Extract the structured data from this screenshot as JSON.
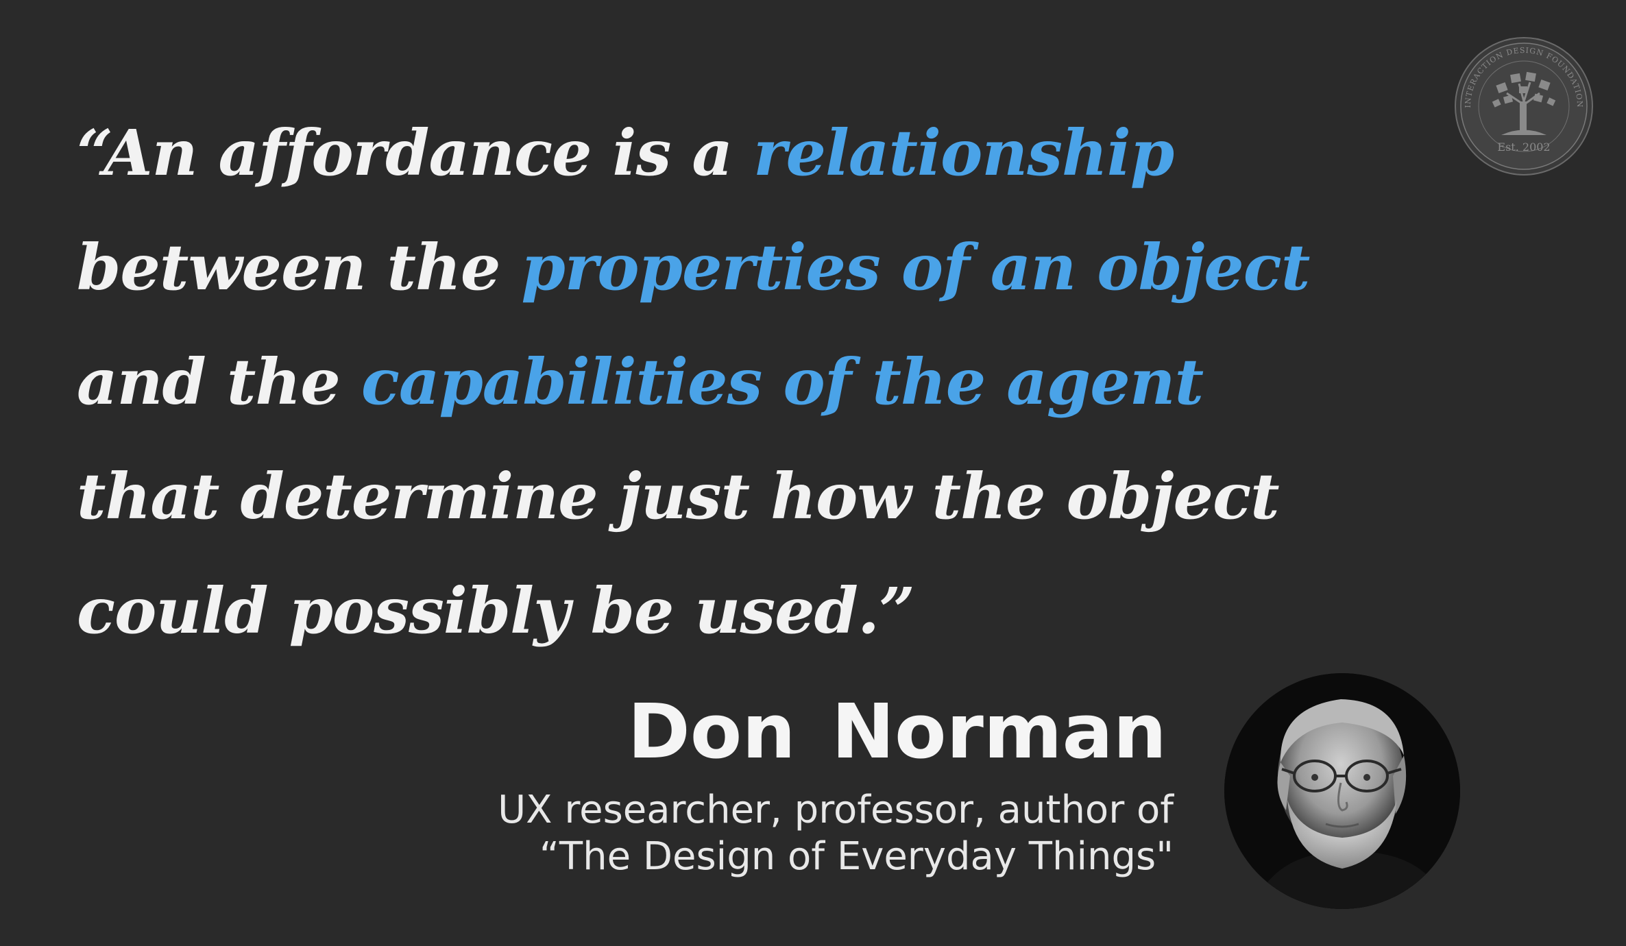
{
  "quote": {
    "lines": [
      [
        {
          "text": "“An affordance is a ",
          "hl": false
        },
        {
          "text": "relationship",
          "hl": true
        }
      ],
      [
        {
          "text": "between the ",
          "hl": false
        },
        {
          "text": "properties of an object",
          "hl": true
        }
      ],
      [
        {
          "text": "and the ",
          "hl": false
        },
        {
          "text": "capabilities of the agent",
          "hl": true
        }
      ],
      [
        {
          "text": "that determine just how the object",
          "hl": false
        }
      ],
      [
        {
          "text": "could possibly be used.”",
          "hl": false
        }
      ]
    ]
  },
  "author": {
    "name": "Don  Norman",
    "role_line1": "UX researcher, professor, author of",
    "role_line2": "“The Design of Everyday Things\""
  },
  "logo": {
    "ring_text": "INTERACTION DESIGN FOUNDATION",
    "est": "Est. 2002"
  },
  "colors": {
    "background": "#2a2a2a",
    "text": "#f2f2f2",
    "highlight": "#4aa3e8",
    "logo": "#8a8a8a"
  }
}
